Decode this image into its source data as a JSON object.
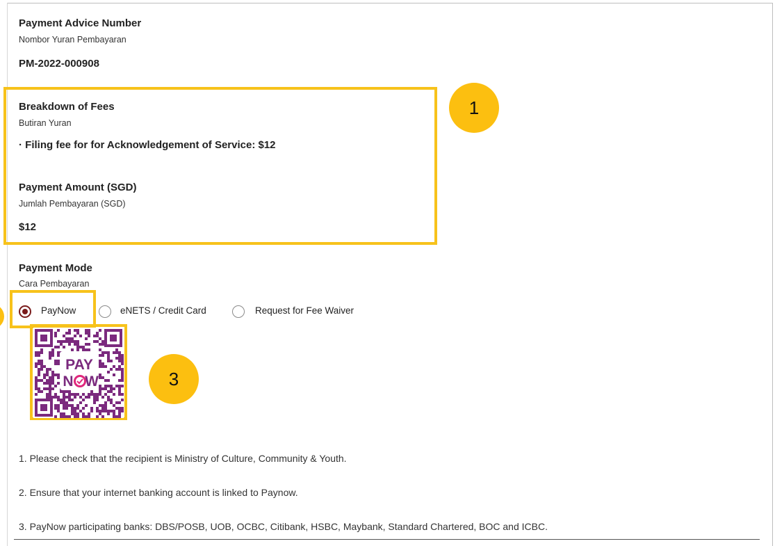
{
  "payment_advice": {
    "label": "Payment Advice Number",
    "sublabel": "Nombor Yuran Pembayaran",
    "value": "PM-2022-000908"
  },
  "breakdown": {
    "label": "Breakdown of Fees",
    "sublabel": "Butiran Yuran",
    "item": "· Filing fee for for Acknowledgement of Service: $12"
  },
  "payment_amount": {
    "label": "Payment Amount (SGD)",
    "sublabel": "Jumlah Pembayaran (SGD)",
    "value": "$12"
  },
  "payment_mode": {
    "label": "Payment Mode",
    "sublabel": "Cara Pembayaran",
    "options": [
      {
        "label": "PayNow",
        "selected": true
      },
      {
        "label": "eNETS / Credit Card",
        "selected": false
      },
      {
        "label": "Request for Fee Waiver",
        "selected": false
      }
    ]
  },
  "qr": {
    "logo_top": "PAY",
    "logo_bottom": "N",
    "logo_end": "W",
    "color": "#7b2a7e"
  },
  "badges": {
    "one": "1",
    "three": "3"
  },
  "notes": [
    "1. Please check that the recipient is Ministry of Culture, Community & Youth.",
    "2. Ensure that your internet banking account is linked to Paynow.",
    "3. PayNow participating banks: DBS/POSB, UOB, OCBC, Citibank, HSBC, Maybank, Standard Chartered, BOC and ICBC."
  ],
  "colors": {
    "highlight": "#f7c21b",
    "badge": "#fcbf10",
    "radio_selected": "#7a1b1b"
  }
}
